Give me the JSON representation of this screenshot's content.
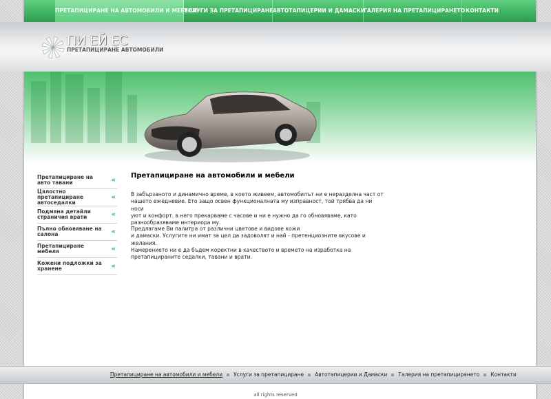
{
  "nav": {
    "items": [
      {
        "label": "ПРЕТАПИЦИРАНЕ НА АВТОМОБИЛИ И МЕБЕЛИ"
      },
      {
        "label": "УСЛУГИ ЗА ПРЕТАПИЦИРАНЕ"
      },
      {
        "label": "АВТОТАПИЦЕРИИ И ДАМАСКИ"
      },
      {
        "label": "ГАЛЕРИЯ НА ПРЕТАПИЦИРАНЕТО"
      },
      {
        "label": "КОНТАКТИ"
      }
    ]
  },
  "logo": {
    "title": "ПИ ЕЙ ЕС",
    "subtitle": "ПРЕТАПИЦИРАНЕ АВТОМОБИЛИ"
  },
  "sidebar": {
    "items": [
      {
        "label": "Претапициране на авто тавани"
      },
      {
        "label": "Цялостно претапициране автоседалки"
      },
      {
        "label": "Подмяна детайли страничия врати"
      },
      {
        "label": "Пълно обновяване на салона"
      },
      {
        "label": "Претапициране мебеля"
      },
      {
        "label": "Кожени подложки за хранене"
      }
    ],
    "arrow": "«"
  },
  "content": {
    "title": "Претапициране на автомобили и мебели",
    "p1_l1": "В забързаното и динамично време, в което живеем, автомобилът ни  е неразделна част от",
    "p1_l2": "нашето ежедневие. Ето защо освен функционалната му изправност, той трябва да ни носи",
    "p1_l3": "уют и конфорт. в него прекарваме с часове и ни е нужно да го обновяваме, като",
    "p1_l4": "разнообразяваме интериора му.",
    "p2_l1": "Предлагаме Ви палитра от различни цветове и видове кожи",
    "p2_l2": "и дамаски. Услугите ни имат за цел да задоволят и най - претенциозните вкусове и желания.",
    "p2_l3": "Намерението ни е да бъдем коректни в качеството и времето на изработка на",
    "p2_l4": "претапицираните седалки, тавани и врати."
  },
  "footer": {
    "links": [
      {
        "label": "Претапициране на автомобили и мебели"
      },
      {
        "label": "Услуги за претапициране"
      },
      {
        "label": "Автотапицерии и Дамаски"
      },
      {
        "label": "Галерия на претапицирането"
      },
      {
        "label": "Контакти"
      }
    ],
    "copyright": "all rights reserved"
  },
  "colors": {
    "accent": "#3fb562",
    "nav_active": "#6fd58c"
  }
}
